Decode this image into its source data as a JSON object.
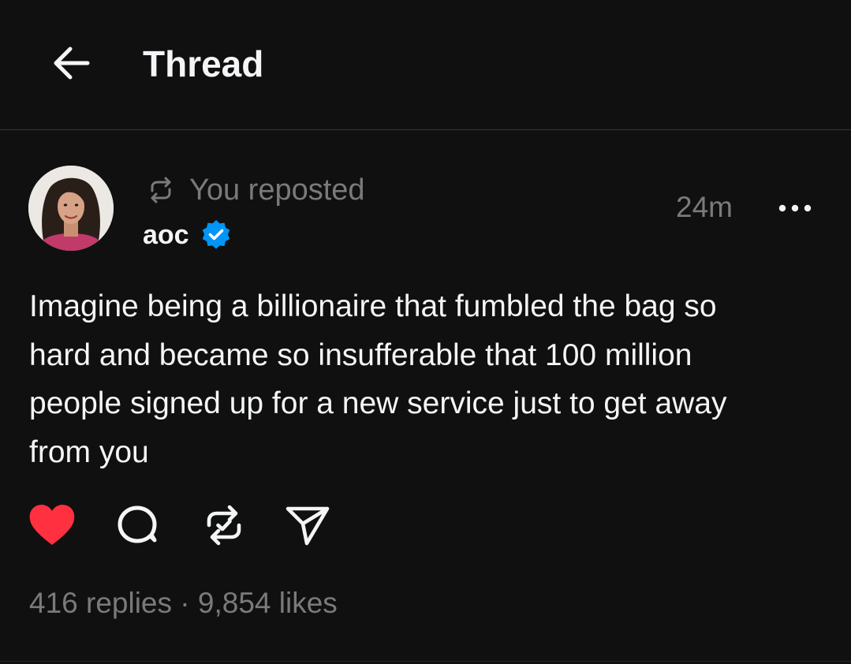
{
  "header": {
    "title": "Thread",
    "back_icon": "arrow-left-icon"
  },
  "post": {
    "repost_label": "You reposted",
    "author": "aoc",
    "verified": true,
    "timestamp": "24m",
    "text": "Imagine being a billionaire that fumbled the bag so\nhard and became so insufferable that 100 million\npeople signed up for a new service just to get away\nfrom you",
    "liked": true,
    "reposted": true
  },
  "actions": [
    {
      "name": "like-icon",
      "color": "#ff3040"
    },
    {
      "name": "comment-icon",
      "color": "#f3f5f7"
    },
    {
      "name": "repost-icon",
      "color": "#f3f5f7"
    },
    {
      "name": "share-icon",
      "color": "#f3f5f7"
    }
  ],
  "stats": {
    "replies": "416 replies",
    "separator": " · ",
    "likes": "9,854 likes"
  },
  "colors": {
    "background": "#101010",
    "text": "#f3f5f7",
    "secondary": "#7a7a7a",
    "verified": "#0095f6",
    "like": "#ff3040"
  }
}
